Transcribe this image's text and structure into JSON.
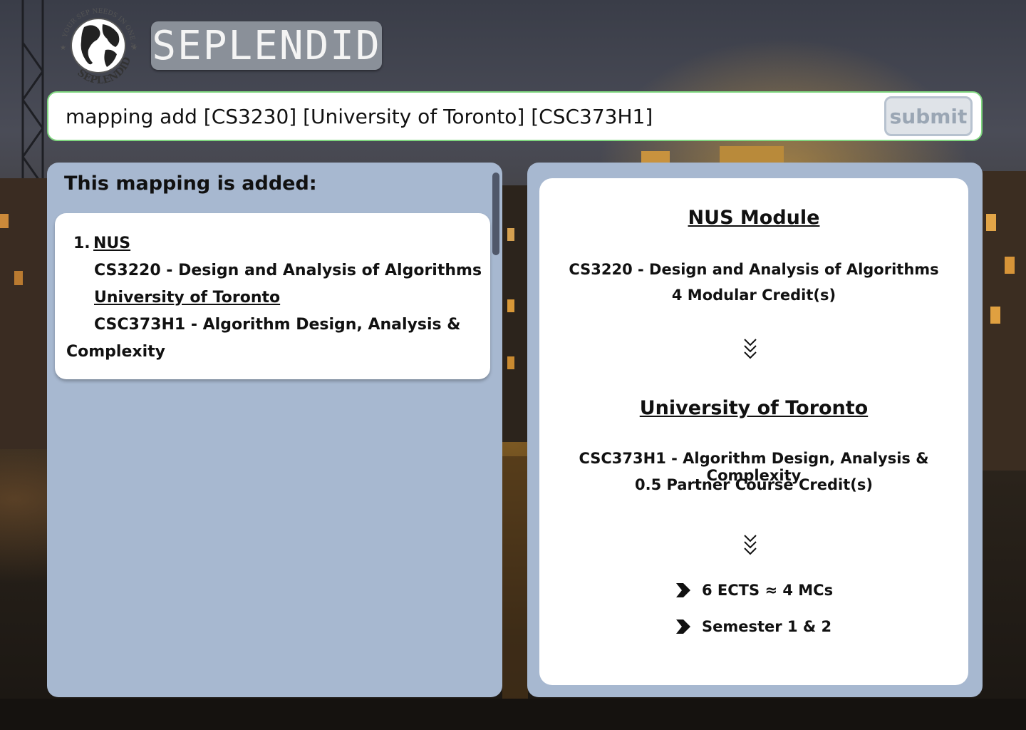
{
  "logo": {
    "ring_text": "YOUR SEP NEEDS IN ONE APP",
    "bottom_text": "SEPLENDID",
    "icon": "globe-icon"
  },
  "brand": {
    "title": "SEPLENDID"
  },
  "command": {
    "value": "mapping add [CS3230] [University of Toronto] [CSC373H1]",
    "submit_label": "submit"
  },
  "result": {
    "title": "This mapping is added:",
    "items": [
      {
        "number": "1.",
        "nus_label": "NUS",
        "nus_module": "CS3220 - Design and Analysis of Algorithms",
        "partner_label": "University of Toronto",
        "partner_module_line1": "CSC373H1 - Algorithm Design, Analysis &",
        "partner_module_line2": "Complexity"
      }
    ]
  },
  "detail": {
    "nus_heading": "NUS Module",
    "nus_module": "CS3220 - Design and Analysis of Algorithms",
    "nus_credits": "4 Modular Credit(s)",
    "partner_heading": "University of Toronto",
    "partner_module": "CSC373H1 - Algorithm Design, Analysis & Complexity",
    "partner_credits": "0.5 Partner Course Credit(s)",
    "notes": [
      "6 ECTS ≈ 4 MCs",
      "Semester 1 & 2"
    ]
  },
  "colors": {
    "panel": "#a7b8d0",
    "command_border": "#7fd67f",
    "brand_box": "#8a9099"
  }
}
